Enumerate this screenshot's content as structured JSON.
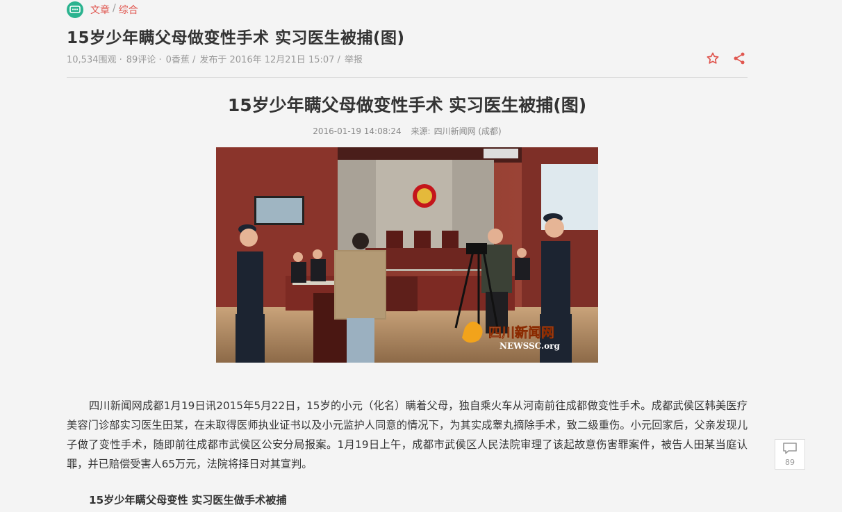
{
  "breadcrumb": {
    "section": "文章",
    "separator": "/",
    "category": "综合"
  },
  "header": {
    "title": "15岁少年瞒父母做变性手术 实习医生被捕(图)",
    "views": "10,534围观 ·",
    "comments": "89评论 ·",
    "bananas": "0香蕉 /",
    "published": "发布于 2016年 12月21日 15:07 /",
    "report": "举报"
  },
  "article": {
    "title": "15岁少年瞒父母做变性手术 实习医生被捕(图)",
    "datetime": "2016-01-19 14:08:24",
    "source_label": "来源:",
    "source": "四川新闻网 (成都)",
    "watermark_cn": "四川新闻网",
    "watermark_en": "NEWSSC.org",
    "paragraph": "四川新闻网成都1月19日讯2015年5月22日，15岁的小元（化名）瞒着父母，独自乘火车从河南前往成都做变性手术。成都武侯区韩美医疗美容门诊部实习医生田某，在未取得医师执业证书以及小元监护人同意的情况下，为其实成睾丸摘除手术，致二级重伤。小元回家后，父亲发现儿子做了变性手术，随即前往成都市武侯区公安分局报案。1月19日上午，成都市武侯区人民法院审理了该起故意伤害罪案件，被告人田某当庭认罪，并已赔偿受害人65万元，法院将择日对其宣判。",
    "subheading": "15岁少年瞒父母变性 实习医生做手术被捕"
  },
  "comment_fab": {
    "count": "89"
  },
  "colors": {
    "accent": "#e0564f",
    "logo": "#2bb38f",
    "background": "#f4f4f4"
  },
  "icons": {
    "logo": "chat-logo-icon",
    "favorite": "star-icon",
    "share": "share-icon",
    "comment": "comment-icon"
  }
}
